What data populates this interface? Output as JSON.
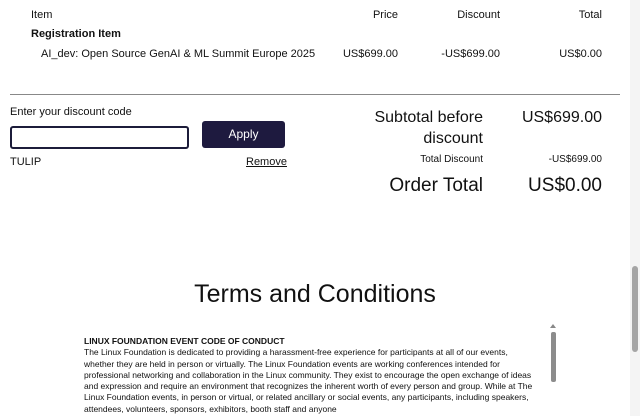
{
  "table": {
    "headers": {
      "item": "Item",
      "price": "Price",
      "discount": "Discount",
      "total": "Total"
    },
    "section_title": "Registration Item",
    "rows": [
      {
        "item": "AI_dev: Open Source GenAI & ML Summit Europe 2025",
        "price": "US$699.00",
        "discount": "-US$699.00",
        "total": "US$0.00"
      }
    ]
  },
  "discount": {
    "label": "Enter your discount code",
    "input_value": "",
    "apply_label": "Apply",
    "applied_code": "TULIP",
    "remove_label": "Remove"
  },
  "totals": {
    "subtotal_label": "Subtotal before discount",
    "subtotal_value": "US$699.00",
    "total_discount_label": "Total Discount",
    "total_discount_value": "-US$699.00",
    "order_total_label": "Order Total",
    "order_total_value": "US$0.00"
  },
  "terms": {
    "title": "Terms and Conditions",
    "heading": "LINUX FOUNDATION EVENT CODE OF CONDUCT",
    "body": "The Linux Foundation is dedicated to providing a harassment-free experience for participants at all of our events, whether they are held in person or virtually. The Linux Foundation events are working conferences intended for professional networking and collaboration in the Linux community. They exist to encourage the open exchange of ideas and expression and require an environment that recognizes the inherent worth of every person and group. While at The Linux Foundation events, in person or virtual, or related ancillary or social events, any participants, including speakers, attendees, volunteers, sponsors, exhibitors, booth staff and anyone"
  },
  "icons": {
    "scroll_up": "scroll-up-arrow-icon"
  }
}
